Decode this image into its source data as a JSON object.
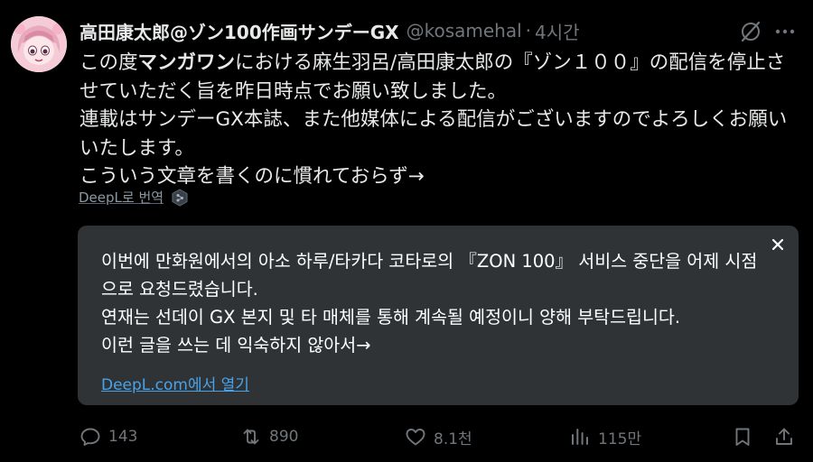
{
  "author": {
    "display_name": "高田康太郎@ゾン100作画サンデーGX",
    "handle": "@kosamehal",
    "separator": "·",
    "time": "4시간"
  },
  "tweet": {
    "line1_pre": "この度",
    "line1_bold": "マンガワン",
    "line1_post": "における麻生羽呂/高田康太郎の『ゾン１００』の配信を停止させていただく旨を昨日時点でお願い致しました。",
    "line2": "連載はサンデーGX本誌、また他媒体による配信がございますのでよろしくお願いいたします。",
    "line3": "こういう文章を書くのに慣れておらず→"
  },
  "translate": {
    "link_label": "DeepL로 번역"
  },
  "translation": {
    "line1": "이번에 만화원에서의 아소 하루/타카다 코타로의 『ZON 100』 서비스 중단을 어제 시점으로 요청드렸습니다.",
    "line2": "연재는 선데이 GX 본지 및 타 매체를 통해 계속될 예정이니 양해 부탁드립니다.",
    "line3": "이런 글을 쓰는 데 익숙하지 않아서→",
    "open_link": "DeepL.com에서 열기"
  },
  "actions": {
    "replies": "143",
    "reposts": "890",
    "likes": "8.1천",
    "views": "115만"
  },
  "colors": {
    "background": "#000000",
    "text": "#e7e9ea",
    "muted": "#71767b",
    "translation_bg": "#2f3336",
    "link": "#4aa3e8"
  },
  "icons": [
    "avatar",
    "grok-icon",
    "more-icon",
    "deepl-icon",
    "close-icon",
    "reply-icon",
    "repost-icon",
    "like-icon",
    "views-icon",
    "bookmark-icon",
    "share-icon"
  ]
}
